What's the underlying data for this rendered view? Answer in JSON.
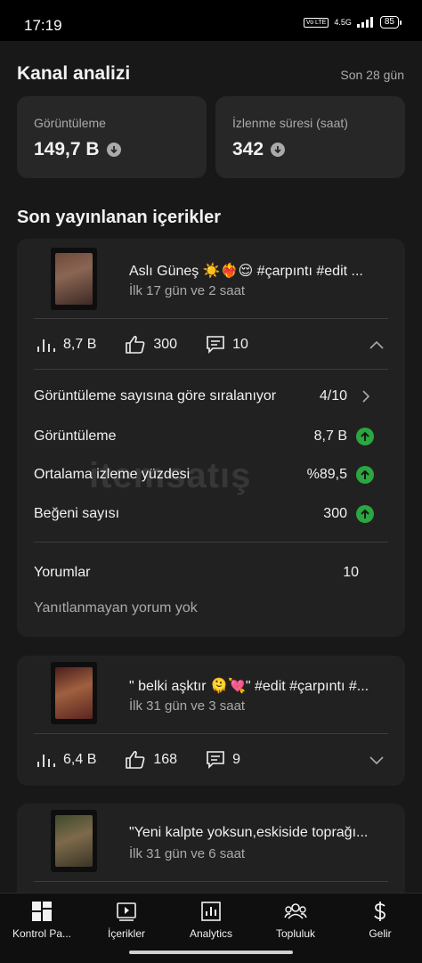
{
  "status_bar": {
    "time": "17:19",
    "network": "4.5G",
    "volte": "Vo LTE",
    "battery": "85"
  },
  "header": {
    "title": "Kanal analizi",
    "period": "Son 28 gün"
  },
  "stats": [
    {
      "label": "Görüntüleme",
      "value": "149,7 B"
    },
    {
      "label": "İzlenme süresi (saat)",
      "value": "342"
    }
  ],
  "section_title": "Son yayınlanan içerikler",
  "videos": [
    {
      "title": "Aslı Güneş ☀️❤️‍🔥😌 #çarpıntı #edit ...",
      "subtitle": "İlk 17 gün ve 2 saat",
      "views": "8,7 B",
      "likes": "300",
      "comments": "10",
      "expanded": true,
      "details": {
        "rank_label": "Görüntüleme sayısına göre sıralanıyor",
        "rank_value": "4/10",
        "views_label": "Görüntüleme",
        "views_value": "8,7 B",
        "avg_label": "Ortalama izleme yüzdesi",
        "avg_value": "%89,5",
        "likes_label": "Beğeni sayısı",
        "likes_value": "300",
        "comments_label": "Yorumlar",
        "comments_value": "10",
        "no_reply": "Yanıtlanmayan yorum yok"
      }
    },
    {
      "title": "\" belki aşktır 🫠💘\" #edit #çarpıntı #...",
      "subtitle": "İlk 31 gün ve 3 saat",
      "views": "6,4 B",
      "likes": "168",
      "comments": "9",
      "expanded": false
    },
    {
      "title": "\"Yeni kalpte yoksun,eskiside toprağı...",
      "subtitle": "İlk 31 gün ve 6 saat"
    }
  ],
  "watermark": "itemsatış",
  "nav": [
    {
      "label": "Kontrol Pa...",
      "icon": "dashboard-icon"
    },
    {
      "label": "İçerikler",
      "icon": "content-icon"
    },
    {
      "label": "Analytics",
      "icon": "analytics-icon"
    },
    {
      "label": "Topluluk",
      "icon": "community-icon"
    },
    {
      "label": "Gelir",
      "icon": "earn-icon"
    }
  ],
  "colors": {
    "background": "#181818",
    "card": "#212121",
    "stat_card": "#272727",
    "up_green": "#2ba640",
    "muted_text": "#aaaaaa"
  }
}
